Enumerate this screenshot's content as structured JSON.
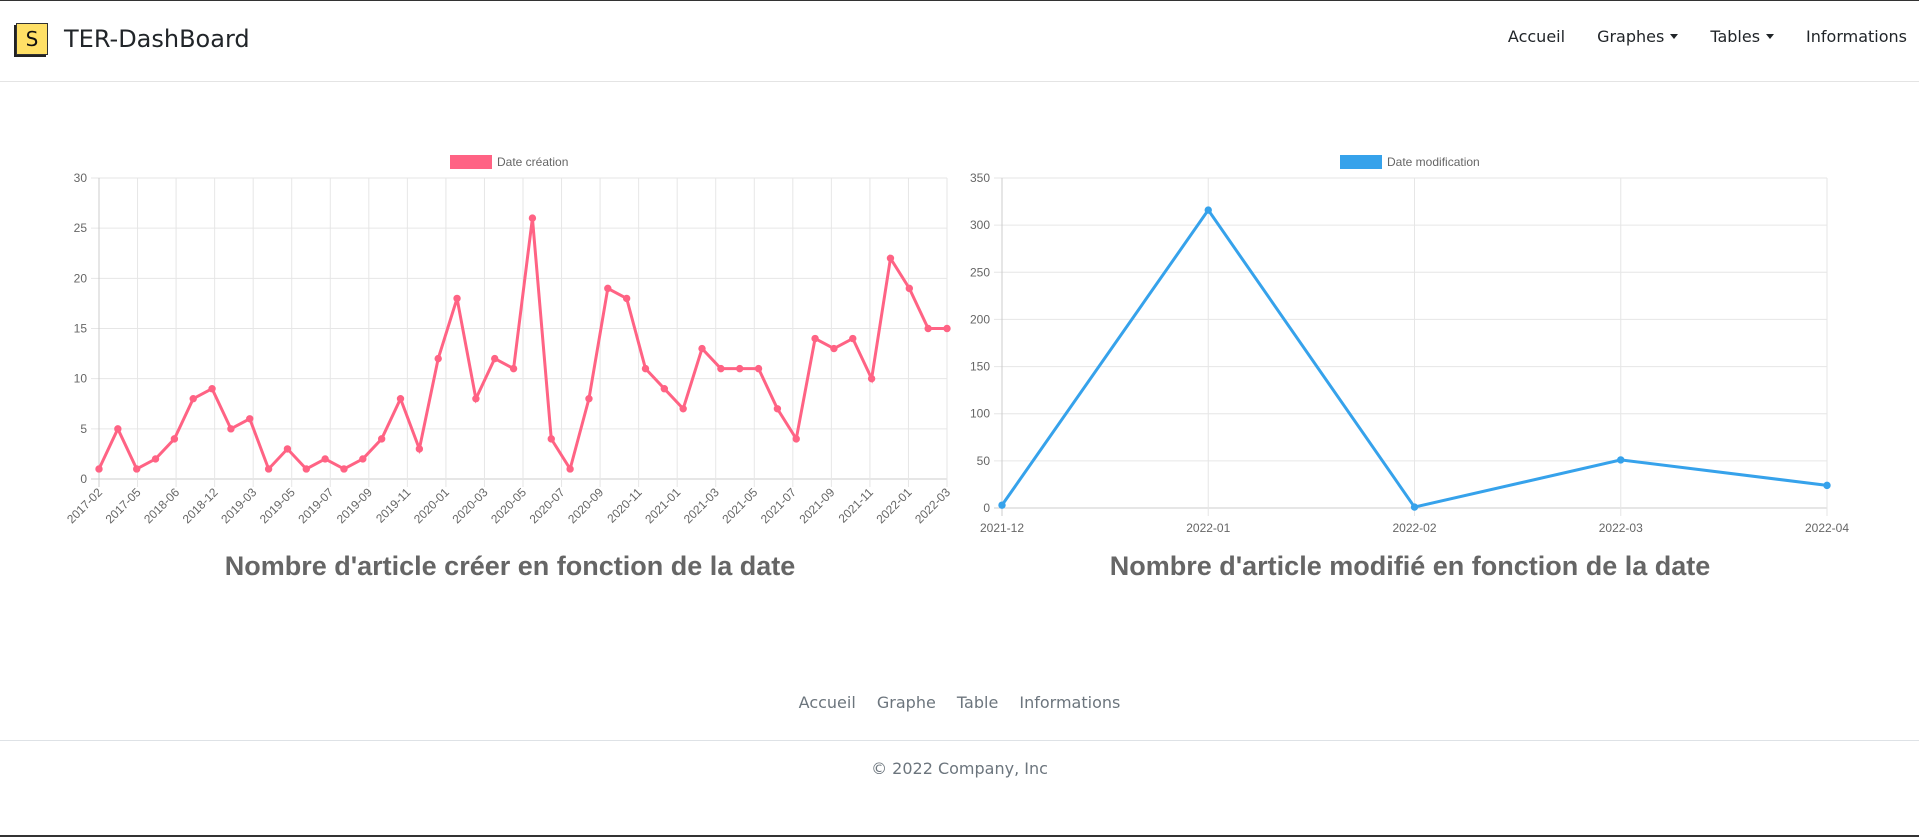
{
  "nav": {
    "brand_logo": "S",
    "brand_name": "TER-DashBoard",
    "items": [
      {
        "label": "Accueil",
        "dropdown": false
      },
      {
        "label": "Graphes",
        "dropdown": true
      },
      {
        "label": "Tables",
        "dropdown": true
      },
      {
        "label": "Informations",
        "dropdown": false
      }
    ]
  },
  "chart_data": [
    {
      "type": "line",
      "title": "Nombre d'article créer en fonction de la date",
      "legend_position": "top",
      "color": "#ff6384",
      "grid": true,
      "ylim": [
        0,
        30
      ],
      "yticks": [
        0,
        5,
        10,
        15,
        20,
        25,
        30
      ],
      "x_tick_labels": [
        "2017-02",
        "2017-05",
        "2018-06",
        "2018-12",
        "2019-03",
        "2019-05",
        "2019-07",
        "2019-09",
        "2019-11",
        "2020-01",
        "2020-03",
        "2020-05",
        "2020-07",
        "2020-09",
        "2020-11",
        "2021-01",
        "2021-03",
        "2021-05",
        "2021-07",
        "2021-09",
        "2021-11",
        "2022-01",
        "2022-03"
      ],
      "series": [
        {
          "name": "Date création",
          "values": [
            1,
            5,
            1,
            2,
            4,
            8,
            9,
            5,
            6,
            1,
            3,
            1,
            2,
            1,
            2,
            4,
            8,
            3,
            12,
            18,
            8,
            12,
            11,
            26,
            4,
            1,
            8,
            19,
            18,
            11,
            9,
            7,
            13,
            11,
            11,
            11,
            7,
            4,
            14,
            13,
            14,
            10,
            22,
            19,
            15,
            15
          ]
        }
      ]
    },
    {
      "type": "line",
      "title": "Nombre d'article modifié en fonction de la date",
      "legend_position": "top",
      "color": "#36a2eb",
      "grid": true,
      "ylim": [
        0,
        350
      ],
      "yticks": [
        0,
        50,
        100,
        150,
        200,
        250,
        300,
        350
      ],
      "categories": [
        "2021-12",
        "2022-01",
        "2022-02",
        "2022-03",
        "2022-04"
      ],
      "series": [
        {
          "name": "Date modification",
          "values": [
            3,
            316,
            1,
            51,
            24
          ]
        }
      ]
    }
  ],
  "footer": {
    "links": [
      "Accueil",
      "Graphe",
      "Table",
      "Informations"
    ],
    "copyright": "© 2022 Company, Inc"
  }
}
